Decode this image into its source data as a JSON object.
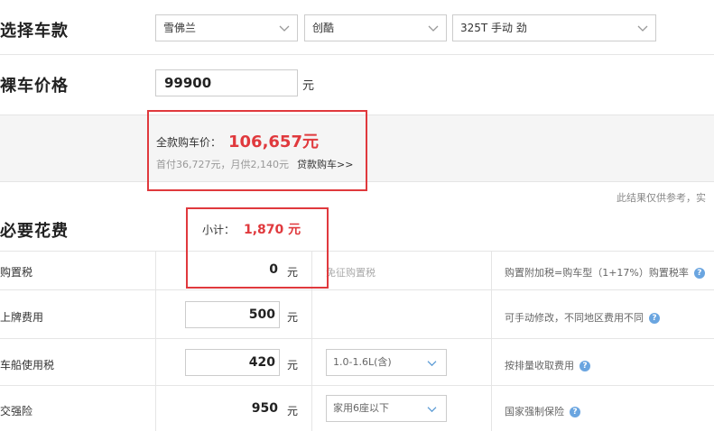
{
  "select_section": {
    "title": "选择车款",
    "brand": "雪佛兰",
    "series": "创酷",
    "model": "325T 手动 劲"
  },
  "price_section": {
    "title": "裸车价格",
    "value": "99900",
    "unit": "元"
  },
  "summary": {
    "total_label": "全款购车价：",
    "total_value": "106,657元",
    "sub_text": "首付36,727元，月供2,140元",
    "loan_link": "贷款购车>>",
    "disclaimer": "此结果仅供参考，实"
  },
  "fees": {
    "title": "必要花费",
    "subtotal_label": "小计：",
    "subtotal_value": "1,870 元",
    "rows": [
      {
        "name": "购置税",
        "value": "0",
        "unit": "元",
        "mid": "免征购置税",
        "note": "购置附加税=购车型（1+17%）购置税率"
      },
      {
        "name": "上牌费用",
        "value": "500",
        "unit": "元",
        "mid": "",
        "note": "可手动修改，不同地区费用不同"
      },
      {
        "name": "车船使用税",
        "value": "420",
        "unit": "元",
        "select": "1.0-1.6L(含)",
        "note": "按排量收取费用"
      },
      {
        "name": "交强险",
        "value": "950",
        "unit": "元",
        "select": "家用6座以下",
        "note": "国家强制保险"
      }
    ]
  },
  "colors": {
    "accent_red": "#e0393d",
    "help_blue": "#6aa5e0"
  }
}
